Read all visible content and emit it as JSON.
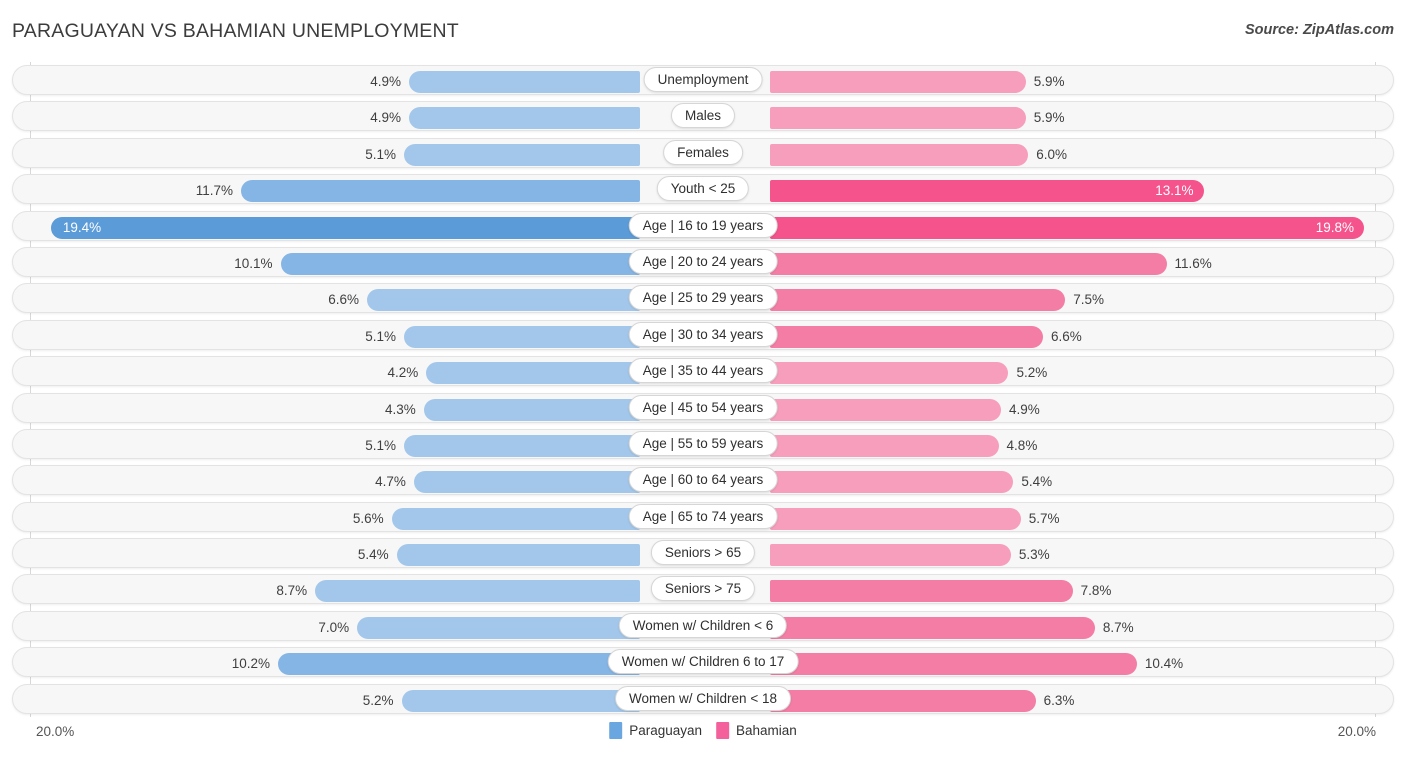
{
  "header": {
    "title": "PARAGUAYAN VS BAHAMIAN UNEMPLOYMENT",
    "source": "Source: ZipAtlas.com"
  },
  "axis": {
    "left_label": "20.0%",
    "right_label": "20.0%",
    "max": 20.0
  },
  "legend": {
    "items": [
      {
        "label": "Paraguayan",
        "color": "#6aa6e0"
      },
      {
        "label": "Bahamian",
        "color": "#f4609b"
      }
    ]
  },
  "colors": {
    "left_light": "#a3c7ea",
    "left_mid": "#85b5e5",
    "left_dark": "#5b9bd8",
    "right_light": "#f79ebc",
    "right_mid": "#f47da6",
    "right_dark": "#f4538c",
    "track": "#f7f7f7",
    "track_border": "#e3e3e3"
  },
  "chart_data": {
    "type": "bar",
    "orientation": "horizontal-diverging",
    "title": "PARAGUAYAN VS BAHAMIAN UNEMPLOYMENT",
    "xlabel": "",
    "ylabel": "",
    "xlim": [
      20.0,
      20.0
    ],
    "grid": true,
    "legend_position": "bottom-center",
    "categories": [
      "Unemployment",
      "Males",
      "Females",
      "Youth < 25",
      "Age | 16 to 19 years",
      "Age | 20 to 24 years",
      "Age | 25 to 29 years",
      "Age | 30 to 34 years",
      "Age | 35 to 44 years",
      "Age | 45 to 54 years",
      "Age | 55 to 59 years",
      "Age | 60 to 64 years",
      "Age | 65 to 74 years",
      "Seniors > 65",
      "Seniors > 75",
      "Women w/ Children < 6",
      "Women w/ Children 6 to 17",
      "Women w/ Children < 18"
    ],
    "series": [
      {
        "name": "Paraguayan",
        "values": [
          4.9,
          4.9,
          5.1,
          11.7,
          19.4,
          10.1,
          6.6,
          5.1,
          4.2,
          4.3,
          5.1,
          4.7,
          5.6,
          5.4,
          8.7,
          7.0,
          10.2,
          5.2
        ]
      },
      {
        "name": "Bahamian",
        "values": [
          5.9,
          5.9,
          6.0,
          13.1,
          19.8,
          11.6,
          7.5,
          6.6,
          5.2,
          4.9,
          4.8,
          5.4,
          5.7,
          5.3,
          7.8,
          8.7,
          10.4,
          6.3
        ]
      }
    ]
  },
  "rows": [
    {
      "label": "Unemployment",
      "left": "4.9%",
      "right": "5.9%",
      "lv": 4.9,
      "rv": 5.9,
      "lin": false,
      "rin": false
    },
    {
      "label": "Males",
      "left": "4.9%",
      "right": "5.9%",
      "lv": 4.9,
      "rv": 5.9,
      "lin": false,
      "rin": false
    },
    {
      "label": "Females",
      "left": "5.1%",
      "right": "6.0%",
      "lv": 5.1,
      "rv": 6.0,
      "lin": false,
      "rin": false
    },
    {
      "label": "Youth < 25",
      "left": "11.7%",
      "right": "13.1%",
      "lv": 11.7,
      "rv": 13.1,
      "lin": false,
      "rin": true
    },
    {
      "label": "Age | 16 to 19 years",
      "left": "19.4%",
      "right": "19.8%",
      "lv": 19.4,
      "rv": 19.8,
      "lin": true,
      "rin": true
    },
    {
      "label": "Age | 20 to 24 years",
      "left": "10.1%",
      "right": "11.6%",
      "lv": 10.1,
      "rv": 11.6,
      "lin": false,
      "rin": false
    },
    {
      "label": "Age | 25 to 29 years",
      "left": "6.6%",
      "right": "7.5%",
      "lv": 6.6,
      "rv": 7.5,
      "lin": false,
      "rin": false
    },
    {
      "label": "Age | 30 to 34 years",
      "left": "5.1%",
      "right": "6.6%",
      "lv": 5.1,
      "rv": 6.6,
      "lin": false,
      "rin": false
    },
    {
      "label": "Age | 35 to 44 years",
      "left": "4.2%",
      "right": "5.2%",
      "lv": 4.2,
      "rv": 5.2,
      "lin": false,
      "rin": false
    },
    {
      "label": "Age | 45 to 54 years",
      "left": "4.3%",
      "right": "4.9%",
      "lv": 4.3,
      "rv": 4.9,
      "lin": false,
      "rin": false
    },
    {
      "label": "Age | 55 to 59 years",
      "left": "5.1%",
      "right": "4.8%",
      "lv": 5.1,
      "rv": 4.8,
      "lin": false,
      "rin": false
    },
    {
      "label": "Age | 60 to 64 years",
      "left": "4.7%",
      "right": "5.4%",
      "lv": 4.7,
      "rv": 5.4,
      "lin": false,
      "rin": false
    },
    {
      "label": "Age | 65 to 74 years",
      "left": "5.6%",
      "right": "5.7%",
      "lv": 5.6,
      "rv": 5.7,
      "lin": false,
      "rin": false
    },
    {
      "label": "Seniors > 65",
      "left": "5.4%",
      "right": "5.3%",
      "lv": 5.4,
      "rv": 5.3,
      "lin": false,
      "rin": false
    },
    {
      "label": "Seniors > 75",
      "left": "8.7%",
      "right": "7.8%",
      "lv": 8.7,
      "rv": 7.8,
      "lin": false,
      "rin": false
    },
    {
      "label": "Women w/ Children < 6",
      "left": "7.0%",
      "right": "8.7%",
      "lv": 7.0,
      "rv": 8.7,
      "lin": false,
      "rin": false
    },
    {
      "label": "Women w/ Children 6 to 17",
      "left": "10.2%",
      "right": "10.4%",
      "lv": 10.2,
      "rv": 10.4,
      "lin": false,
      "rin": false
    },
    {
      "label": "Women w/ Children < 18",
      "left": "5.2%",
      "right": "6.3%",
      "lv": 5.2,
      "rv": 6.3,
      "lin": false,
      "rin": false
    }
  ]
}
